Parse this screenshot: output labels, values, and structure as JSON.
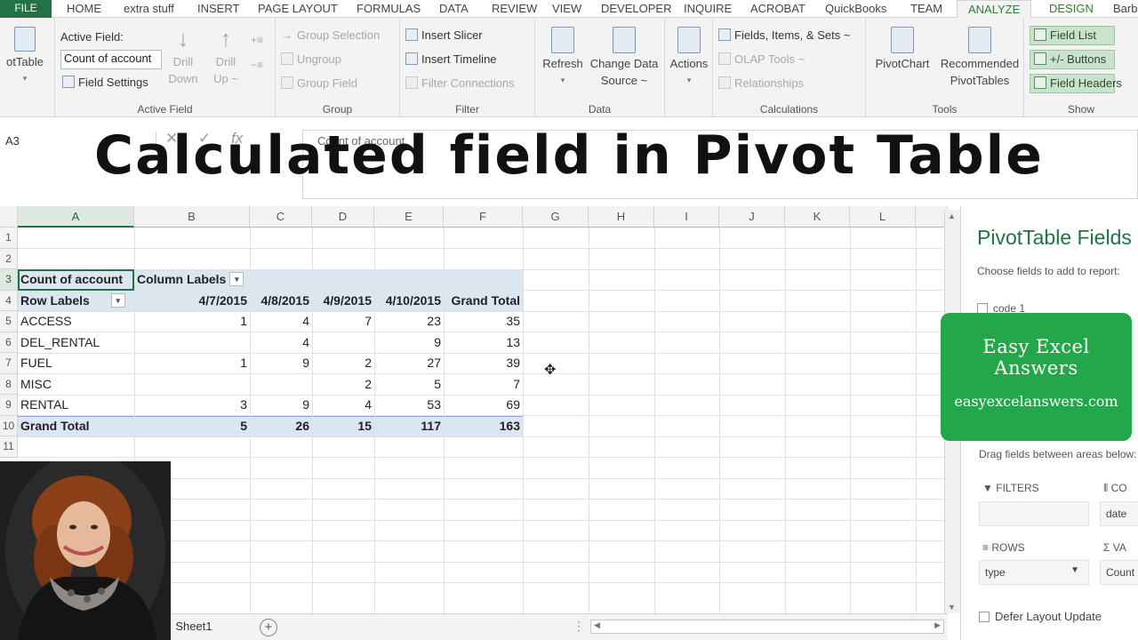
{
  "overlay": {
    "title": "Calculated field in Pivot Table"
  },
  "ribbon_tabs": [
    "FILE",
    "HOME",
    "extra stuff",
    "INSERT",
    "PAGE LAYOUT",
    "FORMULAS",
    "DATA",
    "REVIEW",
    "VIEW",
    "DEVELOPER",
    "INQUIRE",
    "ACROBAT",
    "QuickBooks",
    "TEAM",
    "ANALYZE",
    "DESIGN",
    "Barb"
  ],
  "ribbon": {
    "pivottable_label": "otTable",
    "active_field": {
      "label": "Active Field:",
      "value": "Count of account",
      "settings": "Field Settings",
      "drill_down": [
        "Drill",
        "Down"
      ],
      "drill_up": [
        "Drill",
        "Up ~"
      ],
      "group_label": "Active Field"
    },
    "group": {
      "selection": "Group Selection",
      "ungroup": "Ungroup",
      "field": "Group Field",
      "group_label": "Group"
    },
    "filter": {
      "slicer": "Insert Slicer",
      "timeline": "Insert Timeline",
      "connections": "Filter Connections",
      "group_label": "Filter"
    },
    "data": {
      "refresh": "Refresh",
      "change_source": [
        "Change Data",
        "Source ~"
      ],
      "group_label": "Data"
    },
    "actions": {
      "label": "Actions"
    },
    "calculations": {
      "fields_items": "Fields, Items, & Sets ~",
      "olap": "OLAP Tools ~",
      "relationships": "Relationships",
      "group_label": "Calculations"
    },
    "tools": {
      "pivotchart": "PivotChart",
      "recommended": [
        "Recommended",
        "PivotTables"
      ],
      "group_label": "Tools"
    },
    "show": {
      "field_list": "Field List",
      "buttons": "+/- Buttons",
      "field_headers": "Field Headers",
      "group_label": "Show"
    }
  },
  "formula_bar": {
    "name_box": "A3",
    "content": "Count of account"
  },
  "columns": [
    "A",
    "B",
    "C",
    "D",
    "E",
    "F",
    "G",
    "H",
    "I",
    "J",
    "K",
    "L"
  ],
  "rows": [
    "1",
    "2",
    "3",
    "4",
    "5",
    "6",
    "7",
    "8",
    "9",
    "10",
    "11"
  ],
  "pivot": {
    "corner_label": "Count of account",
    "column_labels": "Column Labels",
    "row_labels": "Row Labels",
    "date_headers": [
      "4/7/2015",
      "4/8/2015",
      "4/9/2015",
      "4/10/2015",
      "Grand Total"
    ],
    "rows": [
      {
        "label": "ACCESS",
        "values": [
          "1",
          "4",
          "7",
          "23",
          "35"
        ]
      },
      {
        "label": "DEL_RENTAL",
        "values": [
          "",
          "4",
          "",
          "9",
          "13"
        ]
      },
      {
        "label": "FUEL",
        "values": [
          "1",
          "9",
          "2",
          "27",
          "39"
        ]
      },
      {
        "label": "MISC",
        "values": [
          "",
          "",
          "2",
          "5",
          "7"
        ]
      },
      {
        "label": "RENTAL",
        "values": [
          "3",
          "9",
          "4",
          "53",
          "69"
        ]
      }
    ],
    "grand_total": {
      "label": "Grand Total",
      "values": [
        "5",
        "26",
        "15",
        "117",
        "163"
      ]
    }
  },
  "sheet_tabs": {
    "active": "Sheet1"
  },
  "pivot_pane": {
    "title": "PivotTable Fields",
    "subtitle": "Choose fields to add to report:",
    "field_item": "code 1",
    "drag_text": "Drag fields between areas below:",
    "filters_label": "FILTERS",
    "columns_label": "CO",
    "columns_value": "date",
    "rows_label": "ROWS",
    "rows_value": "type",
    "values_label": "VA",
    "values_value": "Count",
    "defer_label": "Defer Layout Update"
  },
  "brand": {
    "name": "Easy Excel Answers",
    "url": "easyexcelanswers.com",
    "color": "#22a84a"
  },
  "colors": {
    "excel_green": "#217346",
    "pivot_band": "#dce6f1"
  }
}
